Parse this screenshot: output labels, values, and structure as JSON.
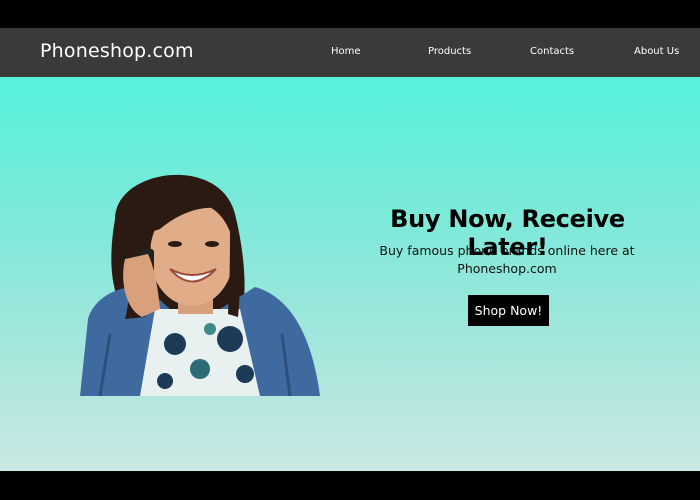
{
  "site": {
    "logo": "Phoneshop.com"
  },
  "nav": {
    "items": [
      {
        "label": "Home"
      },
      {
        "label": "Products"
      },
      {
        "label": "Contacts"
      },
      {
        "label": "About Us"
      }
    ]
  },
  "hero": {
    "headline": "Buy Now, Receive Later!",
    "subtext_line1": "Buy famous phone brands online here at",
    "subtext_line2": "Phoneshop.com",
    "cta_label": "Shop Now!"
  },
  "colors": {
    "nav_bg": "#3b3a3a",
    "hero_top": "#55f2da",
    "hero_bottom": "#c9e9e3",
    "button_bg": "#000000"
  }
}
